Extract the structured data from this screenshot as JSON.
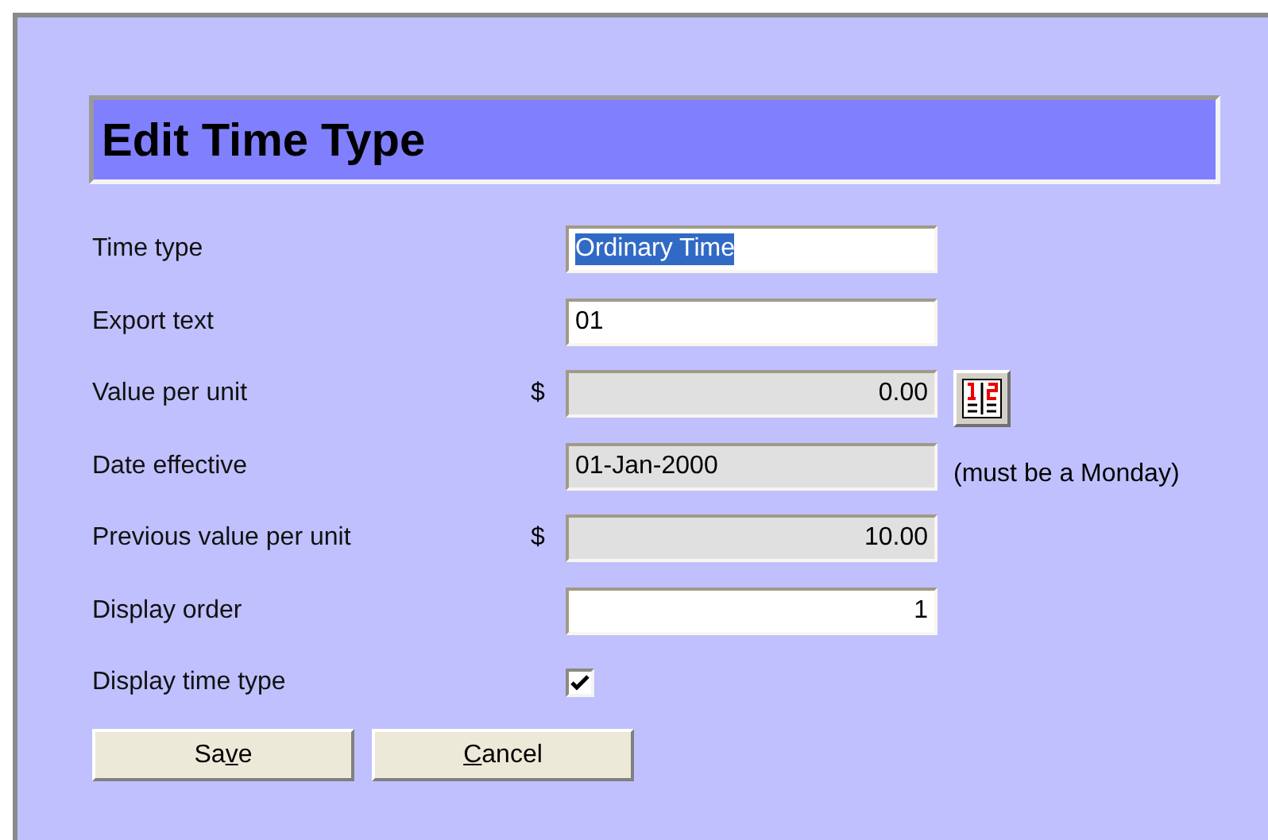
{
  "title": "Edit Time Type",
  "fields": [
    {
      "label": "Time type",
      "kind": "text",
      "value": "Ordinary Time",
      "highlighted": true,
      "disabled": false
    },
    {
      "label": "Export text",
      "kind": "text",
      "value": "01",
      "highlighted": false,
      "disabled": false
    },
    {
      "label": "Value per unit",
      "kind": "number",
      "prefix": "$",
      "value": "0.00",
      "highlighted": false,
      "disabled": true,
      "calculator": true
    },
    {
      "label": "Date effective",
      "kind": "text",
      "value": "01-Jan-2000",
      "highlighted": false,
      "disabled": true,
      "note": "(must be a Monday)"
    },
    {
      "label": "Previous value per unit",
      "kind": "number",
      "prefix": "$",
      "value": "10.00",
      "highlighted": false,
      "disabled": true
    },
    {
      "label": "Display order",
      "kind": "number",
      "value": "1",
      "highlighted": false,
      "disabled": false
    },
    {
      "label": "Display time type",
      "kind": "checkbox",
      "checked": true
    }
  ],
  "buttons": [
    {
      "before": "Sa",
      "key": "v",
      "after": "e"
    },
    {
      "key": "C",
      "after": "ancel"
    }
  ]
}
